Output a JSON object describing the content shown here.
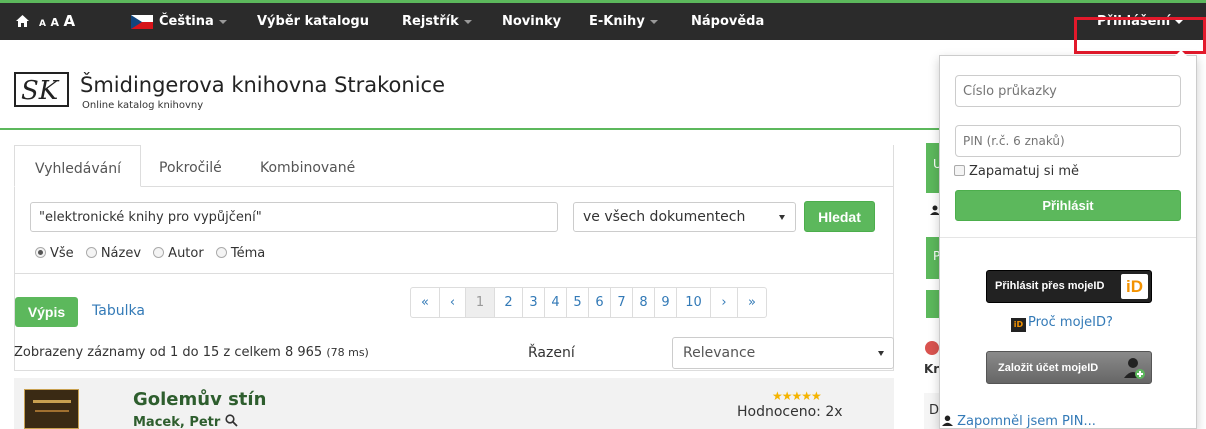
{
  "navbar": {
    "font_size_label": "A A A",
    "language": "Čeština",
    "catalog": "Výběr katalogu",
    "index": "Rejstřík",
    "news": "Novinky",
    "ebooks": "E-Knihy",
    "help": "Nápověda",
    "login": "Přihlášení"
  },
  "header": {
    "logo_text": "SK",
    "title": "Šmidingerova knihovna Strakonice",
    "subtitle": "Online katalog knihovny"
  },
  "search": {
    "tabs": [
      "Vyhledávání",
      "Pokročilé",
      "Kombinované"
    ],
    "query": "\"elektronické knihy pro vypůjčení\"",
    "scope": "ve všech dokumentech",
    "button": "Hledat",
    "radios": [
      "Vše",
      "Název",
      "Autor",
      "Téma"
    ]
  },
  "results": {
    "view_list": "Výpis",
    "view_table": "Tabulka",
    "pages": [
      "«",
      "‹",
      "1",
      "2",
      "3",
      "4",
      "5",
      "6",
      "7",
      "8",
      "9",
      "10",
      "›",
      "»"
    ],
    "current_page": "1",
    "summary": "Zobrazeny záznamy od 1 do 15 z celkem 8 965",
    "timing": "(78 ms)",
    "sort_label": "Řazení",
    "sort_value": "Relevance",
    "items": [
      {
        "title": "Golemův stín",
        "author": "Macek, Petr",
        "rating": "Hodnoceno: 2x",
        "stars": 5
      }
    ]
  },
  "sidebar_peek": {
    "u": "U",
    "p": "P",
    "kr": "Kr",
    "d": "D"
  },
  "login_dropdown": {
    "card_placeholder": "Číslo průkazky",
    "pin_placeholder": "PIN (r.č. 6 znaků)",
    "remember": "Zapamatuj si mě",
    "submit": "Přihlásit",
    "mojeid_login": "Přihlásit přes mojeID",
    "why_mojeid": "Proč mojeID?",
    "create_mojeid": "Založit účet mojeID",
    "forgot_pin": "Zapomněl jsem PIN..."
  },
  "colors": {
    "accent_green": "#5cb85c",
    "navbar": "#2b2b2b",
    "highlight_red": "#e3192b",
    "link_blue": "#337ab7"
  }
}
